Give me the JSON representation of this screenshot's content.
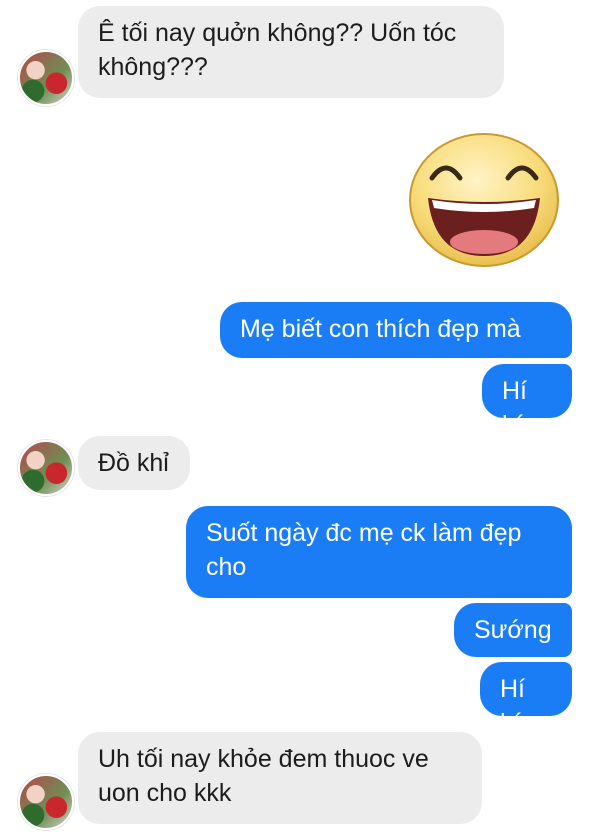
{
  "messages": [
    {
      "side": "in",
      "text": "Ê tối nay quởn không?? Uốn tóc không???"
    },
    {
      "side": "out",
      "type": "sticker",
      "icon": "laughing-face-icon"
    },
    {
      "side": "out",
      "text": "Mẹ biết con thích đẹp mà"
    },
    {
      "side": "out",
      "text": "Hí hí"
    },
    {
      "side": "in",
      "text": "Đồ khỉ"
    },
    {
      "side": "out",
      "text": "Suốt ngày đc mẹ ck làm đẹp cho"
    },
    {
      "side": "out",
      "text": "Sướng"
    },
    {
      "side": "out",
      "text": "Hí hí"
    },
    {
      "side": "in",
      "text": "Uh tối nay khỏe đem thuoc ve uon cho kkk"
    }
  ],
  "colors": {
    "incoming_bubble": "#ececec",
    "outgoing_bubble": "#1a7df5"
  }
}
